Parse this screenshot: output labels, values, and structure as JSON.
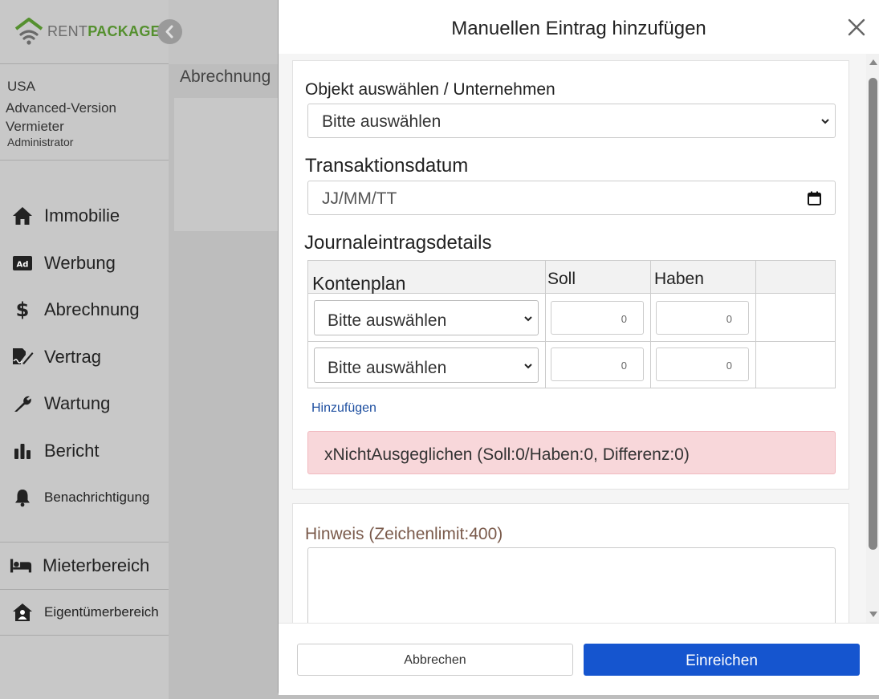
{
  "app": {
    "logo_rent": "RENT",
    "logo_package": "PACKAGE",
    "breadcrumb": "Abrechnung"
  },
  "user": {
    "country": "USA",
    "plan": "Advanced-Version",
    "role": "Vermieter",
    "role_sub": "Administrator"
  },
  "nav": {
    "items": [
      {
        "label": "Immobilie",
        "icon": "home-icon"
      },
      {
        "label": "Werbung",
        "icon": "ad-icon"
      },
      {
        "label": "Abrechnung",
        "icon": "dollar-icon"
      },
      {
        "label": "Vertrag",
        "icon": "contract-sign-icon"
      },
      {
        "label": "Wartung",
        "icon": "wrench-icon"
      },
      {
        "label": "Bericht",
        "icon": "bar-chart-icon"
      },
      {
        "label": "Benachrichtigung",
        "icon": "bell-icon"
      }
    ],
    "tenant_area": "Mieterbereich",
    "owner_area": "Eigentümerbereich"
  },
  "modal": {
    "title": "Manuellen Eintrag hinzufügen",
    "object_label": "Objekt auswählen / Unternehmen",
    "object_value": "Bitte auswählen",
    "date_label": "Transaktionsdatum",
    "date_placeholder": "JJ/MM/TT",
    "journal_label": "Journaleintragsdetails",
    "table": {
      "headers": [
        "Kontenplan",
        "Soll",
        "Haben",
        ""
      ],
      "rows": [
        {
          "account": "Bitte auswählen",
          "debit": "0",
          "credit": "0"
        },
        {
          "account": "Bitte auswählen",
          "debit": "0",
          "credit": "0"
        }
      ]
    },
    "add_link": "Hinzufügen",
    "alert": "xNichtAusgeglichen (Soll:0/Haben:0, Differenz:0)",
    "note_label": "Hinweis (Zeichenlimit:400)",
    "cancel": "Abbrechen",
    "submit": "Einreichen"
  },
  "colors": {
    "brand_green": "#55902f",
    "primary_blue": "#1555cf",
    "alert_bg": "#f8d7da",
    "link_blue": "#1e4fa0"
  }
}
